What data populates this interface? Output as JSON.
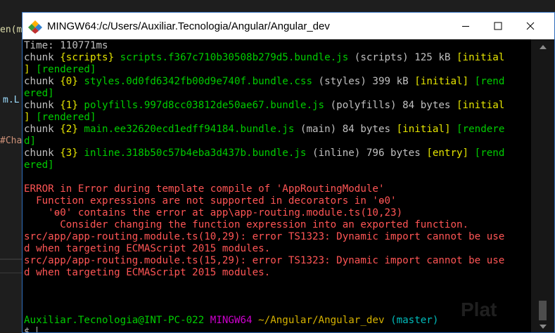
{
  "background_editor": {
    "fragments": [
      "en(m",
      "m.L",
      "#Cha"
    ]
  },
  "window": {
    "title": "MINGW64:/c/Users/Auxiliar.Tecnologia/Angular/Angular_dev",
    "controls": {
      "minimize": "minimize",
      "maximize": "maximize",
      "close": "close"
    }
  },
  "terminal": {
    "lines": [
      [
        {
          "t": "Time: 110771ms",
          "c": "white"
        }
      ],
      [
        {
          "t": "chunk ",
          "c": "white"
        },
        {
          "t": "{scripts}",
          "c": "yellow"
        },
        {
          "t": " ",
          "c": "white"
        },
        {
          "t": "scripts.f367c710b30508b279d5.bundle.js",
          "c": "green"
        },
        {
          "t": " (scripts) 125 kB ",
          "c": "white"
        },
        {
          "t": "[initial",
          "c": "yellow"
        }
      ],
      [
        {
          "t": "] ",
          "c": "yellow"
        },
        {
          "t": "[rendered]",
          "c": "green"
        }
      ],
      [
        {
          "t": "chunk ",
          "c": "white"
        },
        {
          "t": "{0}",
          "c": "yellow"
        },
        {
          "t": " ",
          "c": "white"
        },
        {
          "t": "styles.0d0fd6342fb00d9e740f.bundle.css",
          "c": "green"
        },
        {
          "t": " (styles) 399 kB ",
          "c": "white"
        },
        {
          "t": "[initial]",
          "c": "yellow"
        },
        {
          "t": " ",
          "c": "white"
        },
        {
          "t": "[rend",
          "c": "green"
        }
      ],
      [
        {
          "t": "ered]",
          "c": "green"
        }
      ],
      [
        {
          "t": "chunk ",
          "c": "white"
        },
        {
          "t": "{1}",
          "c": "yellow"
        },
        {
          "t": " ",
          "c": "white"
        },
        {
          "t": "polyfills.997d8cc03812de50ae67.bundle.js",
          "c": "green"
        },
        {
          "t": " (polyfills) 84 bytes ",
          "c": "white"
        },
        {
          "t": "[initial",
          "c": "yellow"
        }
      ],
      [
        {
          "t": "] ",
          "c": "yellow"
        },
        {
          "t": "[rendered]",
          "c": "green"
        }
      ],
      [
        {
          "t": "chunk ",
          "c": "white"
        },
        {
          "t": "{2}",
          "c": "yellow"
        },
        {
          "t": " ",
          "c": "white"
        },
        {
          "t": "main.ee32620ecd1edff94184.bundle.js",
          "c": "green"
        },
        {
          "t": " (main) 84 bytes ",
          "c": "white"
        },
        {
          "t": "[initial]",
          "c": "yellow"
        },
        {
          "t": " ",
          "c": "white"
        },
        {
          "t": "[rendere",
          "c": "green"
        }
      ],
      [
        {
          "t": "d]",
          "c": "green"
        }
      ],
      [
        {
          "t": "chunk ",
          "c": "white"
        },
        {
          "t": "{3}",
          "c": "yellow"
        },
        {
          "t": " ",
          "c": "white"
        },
        {
          "t": "inline.318b50c57b4eba3d437b.bundle.js",
          "c": "green"
        },
        {
          "t": " (inline) 796 bytes ",
          "c": "white"
        },
        {
          "t": "[entry]",
          "c": "yellow"
        },
        {
          "t": " ",
          "c": "white"
        },
        {
          "t": "[rend",
          "c": "green"
        }
      ],
      [
        {
          "t": "ered]",
          "c": "green"
        }
      ],
      [
        {
          "t": "",
          "c": "white"
        }
      ],
      [
        {
          "t": "ERROR in Error during template compile of 'AppRoutingModule'",
          "c": "red"
        }
      ],
      [
        {
          "t": "  Function expressions are not supported in decorators in 'ɵ0'",
          "c": "red"
        }
      ],
      [
        {
          "t": "    'ɵ0' contains the error at app\\app-routing.module.ts(10,23)",
          "c": "red"
        }
      ],
      [
        {
          "t": "      Consider changing the function expression into an exported function.",
          "c": "red"
        }
      ],
      [
        {
          "t": "src/app/app-routing.module.ts(10,29): error TS1323: Dynamic import cannot be use",
          "c": "red"
        }
      ],
      [
        {
          "t": "d when targeting ECMAScript 2015 modules.",
          "c": "red"
        }
      ],
      [
        {
          "t": "src/app/app-routing.module.ts(15,29): error TS1323: Dynamic import cannot be use",
          "c": "red"
        }
      ],
      [
        {
          "t": "d when targeting ECMAScript 2015 modules.",
          "c": "red"
        }
      ],
      [
        {
          "t": "",
          "c": "white"
        }
      ],
      [
        {
          "t": "",
          "c": "white"
        }
      ],
      [
        {
          "t": "",
          "c": "white"
        }
      ]
    ],
    "prompt": {
      "user_host": "Auxiliar.Tecnologia@INT-PC-022",
      "shell": "MINGW64",
      "path": "~/Angular/Angular_dev",
      "branch": "(master)",
      "symbol": "$"
    }
  },
  "watermark": "Plat",
  "colors": {
    "green": "#00cd00",
    "yellow": "#e5e500",
    "red": "#ff5555",
    "purple": "#cd00cd",
    "gold": "#d7b300",
    "cyan": "#00bcbc",
    "white": "#c0c0c0",
    "window_border": "#2f6dbb"
  }
}
